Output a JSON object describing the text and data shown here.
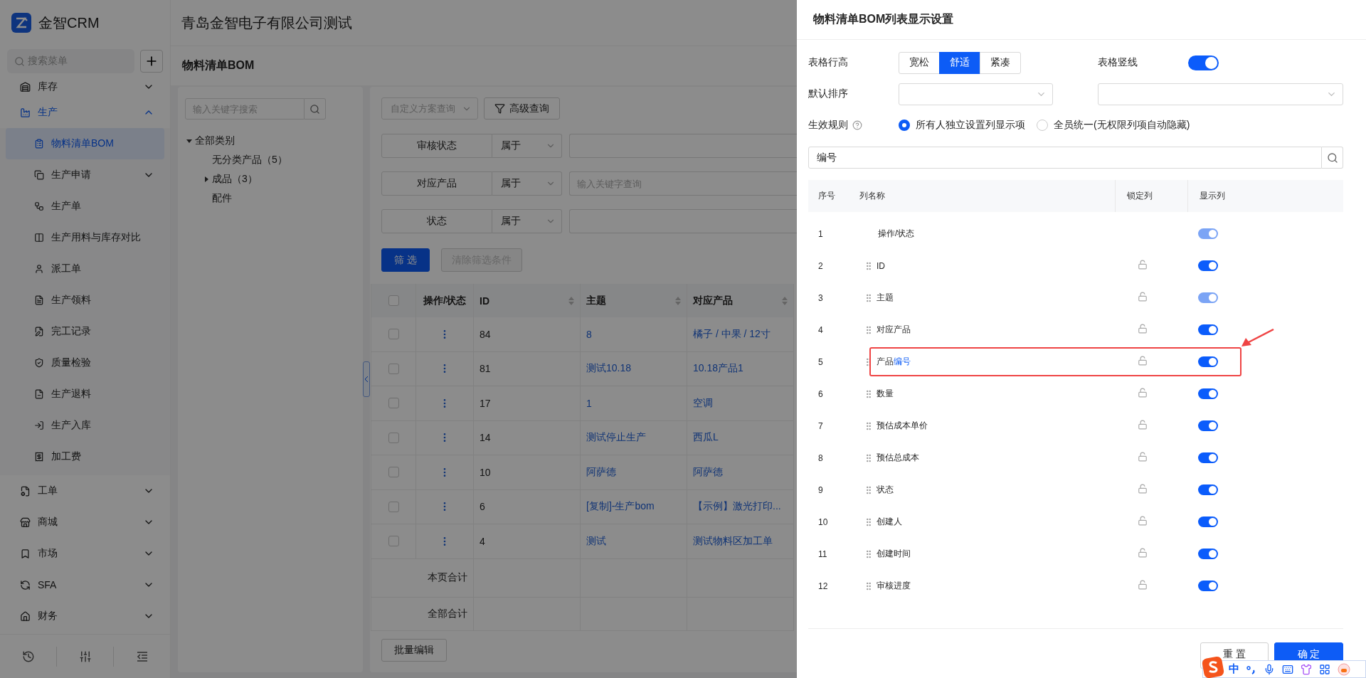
{
  "sidebar": {
    "logo": "金智CRM",
    "search_placeholder": "搜索菜单",
    "items": [
      {
        "label": "库存",
        "expanded": false,
        "selected": false
      },
      {
        "label": "生产",
        "expanded": true,
        "selected": false,
        "children": [
          {
            "label": "物料清单BOM",
            "selected": true
          },
          {
            "label": "生产申请",
            "selected": false,
            "expanded": false
          },
          {
            "label": "生产单",
            "selected": false
          },
          {
            "label": "生产用料与库存对比",
            "selected": false
          },
          {
            "label": "派工单",
            "selected": false
          },
          {
            "label": "生产领料",
            "selected": false
          },
          {
            "label": "完工记录",
            "selected": false
          },
          {
            "label": "质量检验",
            "selected": false
          },
          {
            "label": "生产退料",
            "selected": false
          },
          {
            "label": "生产入库",
            "selected": false
          },
          {
            "label": "加工费",
            "selected": false
          }
        ]
      },
      {
        "label": "工单",
        "expanded": false,
        "selected": false
      },
      {
        "label": "商城",
        "expanded": false,
        "selected": false
      },
      {
        "label": "市场",
        "expanded": false,
        "selected": false
      },
      {
        "label": "SFA",
        "expanded": false,
        "selected": false
      },
      {
        "label": "财务",
        "expanded": false,
        "selected": false
      }
    ]
  },
  "header": {
    "company": "青岛金智电子有限公司测试"
  },
  "page_title": "物料清单BOM",
  "category_panel": {
    "search_placeholder": "输入关键字搜索",
    "tree": [
      {
        "label": "全部类别",
        "expanded": true,
        "children": [
          {
            "label": "无分类产品（5）"
          },
          {
            "label": "成品（3）",
            "expanded": false
          },
          {
            "label": "配件"
          }
        ]
      }
    ]
  },
  "toolbar": {
    "scheme_placeholder": "自定义方案查询",
    "advanced_button": "高级查询"
  },
  "filters": [
    {
      "label": "审核状态",
      "operator": "属于"
    },
    {
      "label": "对应产品",
      "operator": "属于",
      "placeholder": "输入关键字查询"
    },
    {
      "label": "状态",
      "operator": "属于"
    }
  ],
  "filter_buttons": [
    {
      "label": "筛 选",
      "disabled": false,
      "kind": "primary"
    },
    {
      "label": "清除筛选条件",
      "disabled": true,
      "kind": "default"
    }
  ],
  "table": {
    "header_checked": false,
    "columns": [
      {
        "label": "操作/状态",
        "sortable": false
      },
      {
        "label": "ID",
        "sortable": true
      },
      {
        "label": "主题",
        "sortable": true
      },
      {
        "label": "对应产品",
        "sortable": true
      }
    ],
    "rows": [
      {
        "checked": false,
        "id": "84",
        "subject": "8",
        "product": "橘子 / 中果 / 12寸"
      },
      {
        "checked": false,
        "id": "81",
        "subject": "测试10.18",
        "product": "10.18产品1"
      },
      {
        "checked": false,
        "id": "17",
        "subject": "1",
        "product": "空调"
      },
      {
        "checked": false,
        "id": "14",
        "subject": "测试停止生产",
        "product": "西瓜L"
      },
      {
        "checked": false,
        "id": "10",
        "subject": "阿萨德",
        "product": "阿萨德"
      },
      {
        "checked": false,
        "id": "6",
        "subject": "[复制]-生产bom",
        "product": "【示例】激光打印..."
      },
      {
        "checked": false,
        "id": "4",
        "subject": "测试",
        "product": "测试物料区加工单"
      }
    ],
    "summary": [
      "本页合计",
      "全部合计"
    ]
  },
  "batch_button": "批量编辑",
  "drawer": {
    "title": "物料清单BOM列表显示设置",
    "row_height": {
      "label": "表格行高",
      "options": [
        {
          "label": "宽松",
          "selected": false
        },
        {
          "label": "舒适",
          "selected": true
        },
        {
          "label": "紧凑",
          "selected": false
        }
      ]
    },
    "vertical_lines": {
      "label": "表格竖线",
      "on": true
    },
    "default_sort": {
      "label": "默认排序"
    },
    "rule": {
      "label": "生效规则",
      "options": [
        {
          "label": "所有人独立设置列显示项",
          "selected": true
        },
        {
          "label": "全员统一(无权限列项自动隐藏)",
          "selected": false
        }
      ]
    },
    "search": {
      "value": "编号"
    },
    "headers": [
      "序号",
      "列名称",
      "锁定列",
      "显示列"
    ],
    "rows": [
      {
        "index": "1",
        "name": "操作/状态",
        "fixed": true,
        "visible": true,
        "switch_disabled": true,
        "annotated": false
      },
      {
        "index": "2",
        "name": "ID",
        "fixed": false,
        "visible": true,
        "switch_disabled": false,
        "annotated": false
      },
      {
        "index": "3",
        "name": "主题",
        "fixed": false,
        "visible": true,
        "switch_disabled": true,
        "annotated": false
      },
      {
        "index": "4",
        "name": "对应产品",
        "fixed": false,
        "visible": true,
        "switch_disabled": false,
        "annotated": false
      },
      {
        "index": "5",
        "name": "产品",
        "match": "编号",
        "fixed": false,
        "visible": true,
        "switch_disabled": false,
        "annotated": true
      },
      {
        "index": "6",
        "name": "数量",
        "fixed": false,
        "visible": true,
        "switch_disabled": false,
        "annotated": false
      },
      {
        "index": "7",
        "name": "预估成本单价",
        "fixed": false,
        "visible": true,
        "switch_disabled": false,
        "annotated": false
      },
      {
        "index": "8",
        "name": "预估总成本",
        "fixed": false,
        "visible": true,
        "switch_disabled": false,
        "annotated": false
      },
      {
        "index": "9",
        "name": "状态",
        "fixed": false,
        "visible": true,
        "switch_disabled": false,
        "annotated": false
      },
      {
        "index": "10",
        "name": "创建人",
        "fixed": false,
        "visible": true,
        "switch_disabled": false,
        "annotated": false
      },
      {
        "index": "11",
        "name": "创建时间",
        "fixed": false,
        "visible": true,
        "switch_disabled": false,
        "annotated": false
      },
      {
        "index": "12",
        "name": "审核进度",
        "fixed": false,
        "visible": true,
        "switch_disabled": false,
        "annotated": false
      }
    ],
    "buttons": [
      {
        "label": "重 置",
        "kind": "default"
      },
      {
        "label": "确 定",
        "kind": "primary"
      }
    ]
  },
  "ime": {
    "mode": "中"
  }
}
